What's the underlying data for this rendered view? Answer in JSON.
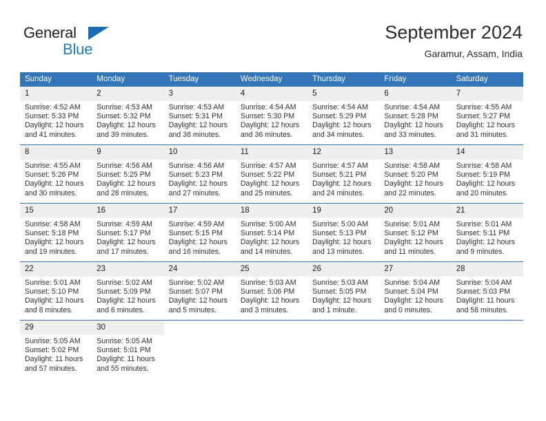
{
  "brand": {
    "name_part1": "General",
    "name_part2": "Blue",
    "triangle_color": "#1a6cb5",
    "text_color_part1": "#231f20",
    "text_color_part2": "#1f7ac4"
  },
  "header": {
    "title": "September 2024",
    "location": "Garamur, Assam, India"
  },
  "theme": {
    "header_row_bg": "#3275b8",
    "header_row_text": "#ffffff",
    "daynum_bg": "#efefef",
    "grid_line": "#3275b8",
    "body_text": "#2f2f2f"
  },
  "columns": [
    "Sunday",
    "Monday",
    "Tuesday",
    "Wednesday",
    "Thursday",
    "Friday",
    "Saturday"
  ],
  "weeks": [
    [
      {
        "day": "1",
        "sunrise": "Sunrise: 4:52 AM",
        "sunset": "Sunset: 5:33 PM",
        "daylight_l1": "Daylight: 12 hours",
        "daylight_l2": "and 41 minutes."
      },
      {
        "day": "2",
        "sunrise": "Sunrise: 4:53 AM",
        "sunset": "Sunset: 5:32 PM",
        "daylight_l1": "Daylight: 12 hours",
        "daylight_l2": "and 39 minutes."
      },
      {
        "day": "3",
        "sunrise": "Sunrise: 4:53 AM",
        "sunset": "Sunset: 5:31 PM",
        "daylight_l1": "Daylight: 12 hours",
        "daylight_l2": "and 38 minutes."
      },
      {
        "day": "4",
        "sunrise": "Sunrise: 4:54 AM",
        "sunset": "Sunset: 5:30 PM",
        "daylight_l1": "Daylight: 12 hours",
        "daylight_l2": "and 36 minutes."
      },
      {
        "day": "5",
        "sunrise": "Sunrise: 4:54 AM",
        "sunset": "Sunset: 5:29 PM",
        "daylight_l1": "Daylight: 12 hours",
        "daylight_l2": "and 34 minutes."
      },
      {
        "day": "6",
        "sunrise": "Sunrise: 4:54 AM",
        "sunset": "Sunset: 5:28 PM",
        "daylight_l1": "Daylight: 12 hours",
        "daylight_l2": "and 33 minutes."
      },
      {
        "day": "7",
        "sunrise": "Sunrise: 4:55 AM",
        "sunset": "Sunset: 5:27 PM",
        "daylight_l1": "Daylight: 12 hours",
        "daylight_l2": "and 31 minutes."
      }
    ],
    [
      {
        "day": "8",
        "sunrise": "Sunrise: 4:55 AM",
        "sunset": "Sunset: 5:26 PM",
        "daylight_l1": "Daylight: 12 hours",
        "daylight_l2": "and 30 minutes."
      },
      {
        "day": "9",
        "sunrise": "Sunrise: 4:56 AM",
        "sunset": "Sunset: 5:25 PM",
        "daylight_l1": "Daylight: 12 hours",
        "daylight_l2": "and 28 minutes."
      },
      {
        "day": "10",
        "sunrise": "Sunrise: 4:56 AM",
        "sunset": "Sunset: 5:23 PM",
        "daylight_l1": "Daylight: 12 hours",
        "daylight_l2": "and 27 minutes."
      },
      {
        "day": "11",
        "sunrise": "Sunrise: 4:57 AM",
        "sunset": "Sunset: 5:22 PM",
        "daylight_l1": "Daylight: 12 hours",
        "daylight_l2": "and 25 minutes."
      },
      {
        "day": "12",
        "sunrise": "Sunrise: 4:57 AM",
        "sunset": "Sunset: 5:21 PM",
        "daylight_l1": "Daylight: 12 hours",
        "daylight_l2": "and 24 minutes."
      },
      {
        "day": "13",
        "sunrise": "Sunrise: 4:58 AM",
        "sunset": "Sunset: 5:20 PM",
        "daylight_l1": "Daylight: 12 hours",
        "daylight_l2": "and 22 minutes."
      },
      {
        "day": "14",
        "sunrise": "Sunrise: 4:58 AM",
        "sunset": "Sunset: 5:19 PM",
        "daylight_l1": "Daylight: 12 hours",
        "daylight_l2": "and 20 minutes."
      }
    ],
    [
      {
        "day": "15",
        "sunrise": "Sunrise: 4:58 AM",
        "sunset": "Sunset: 5:18 PM",
        "daylight_l1": "Daylight: 12 hours",
        "daylight_l2": "and 19 minutes."
      },
      {
        "day": "16",
        "sunrise": "Sunrise: 4:59 AM",
        "sunset": "Sunset: 5:17 PM",
        "daylight_l1": "Daylight: 12 hours",
        "daylight_l2": "and 17 minutes."
      },
      {
        "day": "17",
        "sunrise": "Sunrise: 4:59 AM",
        "sunset": "Sunset: 5:15 PM",
        "daylight_l1": "Daylight: 12 hours",
        "daylight_l2": "and 16 minutes."
      },
      {
        "day": "18",
        "sunrise": "Sunrise: 5:00 AM",
        "sunset": "Sunset: 5:14 PM",
        "daylight_l1": "Daylight: 12 hours",
        "daylight_l2": "and 14 minutes."
      },
      {
        "day": "19",
        "sunrise": "Sunrise: 5:00 AM",
        "sunset": "Sunset: 5:13 PM",
        "daylight_l1": "Daylight: 12 hours",
        "daylight_l2": "and 13 minutes."
      },
      {
        "day": "20",
        "sunrise": "Sunrise: 5:01 AM",
        "sunset": "Sunset: 5:12 PM",
        "daylight_l1": "Daylight: 12 hours",
        "daylight_l2": "and 11 minutes."
      },
      {
        "day": "21",
        "sunrise": "Sunrise: 5:01 AM",
        "sunset": "Sunset: 5:11 PM",
        "daylight_l1": "Daylight: 12 hours",
        "daylight_l2": "and 9 minutes."
      }
    ],
    [
      {
        "day": "22",
        "sunrise": "Sunrise: 5:01 AM",
        "sunset": "Sunset: 5:10 PM",
        "daylight_l1": "Daylight: 12 hours",
        "daylight_l2": "and 8 minutes."
      },
      {
        "day": "23",
        "sunrise": "Sunrise: 5:02 AM",
        "sunset": "Sunset: 5:09 PM",
        "daylight_l1": "Daylight: 12 hours",
        "daylight_l2": "and 6 minutes."
      },
      {
        "day": "24",
        "sunrise": "Sunrise: 5:02 AM",
        "sunset": "Sunset: 5:07 PM",
        "daylight_l1": "Daylight: 12 hours",
        "daylight_l2": "and 5 minutes."
      },
      {
        "day": "25",
        "sunrise": "Sunrise: 5:03 AM",
        "sunset": "Sunset: 5:06 PM",
        "daylight_l1": "Daylight: 12 hours",
        "daylight_l2": "and 3 minutes."
      },
      {
        "day": "26",
        "sunrise": "Sunrise: 5:03 AM",
        "sunset": "Sunset: 5:05 PM",
        "daylight_l1": "Daylight: 12 hours",
        "daylight_l2": "and 1 minute."
      },
      {
        "day": "27",
        "sunrise": "Sunrise: 5:04 AM",
        "sunset": "Sunset: 5:04 PM",
        "daylight_l1": "Daylight: 12 hours",
        "daylight_l2": "and 0 minutes."
      },
      {
        "day": "28",
        "sunrise": "Sunrise: 5:04 AM",
        "sunset": "Sunset: 5:03 PM",
        "daylight_l1": "Daylight: 11 hours",
        "daylight_l2": "and 58 minutes."
      }
    ],
    [
      {
        "day": "29",
        "sunrise": "Sunrise: 5:05 AM",
        "sunset": "Sunset: 5:02 PM",
        "daylight_l1": "Daylight: 11 hours",
        "daylight_l2": "and 57 minutes."
      },
      {
        "day": "30",
        "sunrise": "Sunrise: 5:05 AM",
        "sunset": "Sunset: 5:01 PM",
        "daylight_l1": "Daylight: 11 hours",
        "daylight_l2": "and 55 minutes."
      },
      {
        "day": "",
        "sunrise": "",
        "sunset": "",
        "daylight_l1": "",
        "daylight_l2": ""
      },
      {
        "day": "",
        "sunrise": "",
        "sunset": "",
        "daylight_l1": "",
        "daylight_l2": ""
      },
      {
        "day": "",
        "sunrise": "",
        "sunset": "",
        "daylight_l1": "",
        "daylight_l2": ""
      },
      {
        "day": "",
        "sunrise": "",
        "sunset": "",
        "daylight_l1": "",
        "daylight_l2": ""
      },
      {
        "day": "",
        "sunrise": "",
        "sunset": "",
        "daylight_l1": "",
        "daylight_l2": ""
      }
    ]
  ]
}
